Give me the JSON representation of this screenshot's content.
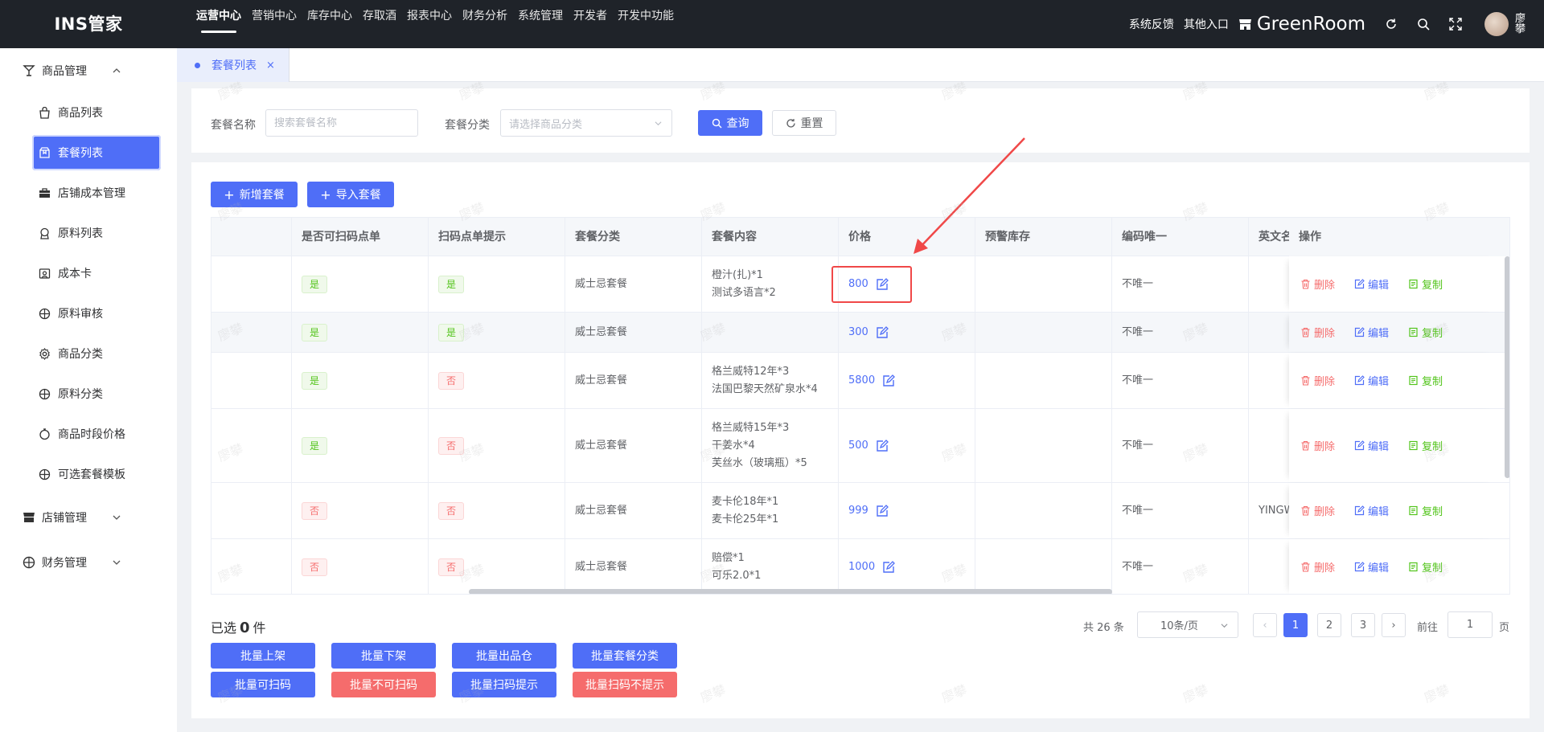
{
  "app": {
    "logo": "INS管家"
  },
  "topnav": [
    {
      "label": "运营中心",
      "active": true
    },
    {
      "label": "营销中心"
    },
    {
      "label": "库存中心"
    },
    {
      "label": "存取酒"
    },
    {
      "label": "报表中心"
    },
    {
      "label": "财务分析"
    },
    {
      "label": "系统管理"
    },
    {
      "label": "开发者"
    },
    {
      "label": "开发中功能"
    }
  ],
  "topright": {
    "feedback": "系统反馈",
    "other_entry": "其他入口",
    "store_name": "GreenRoom",
    "username": "廖攀"
  },
  "sidebar": {
    "groups": [
      {
        "label": "商品管理",
        "icon": "wine-glass-icon",
        "expanded": true
      },
      {
        "label": "店铺管理",
        "icon": "store-icon",
        "expanded": false
      },
      {
        "label": "财务管理",
        "icon": "finance-icon",
        "expanded": false
      }
    ],
    "items": [
      {
        "label": "商品列表",
        "icon": "bag-icon"
      },
      {
        "label": "套餐列表",
        "icon": "package-icon",
        "active": true
      },
      {
        "label": "店铺成本管理",
        "icon": "briefcase-icon"
      },
      {
        "label": "原料列表",
        "icon": "ingredient-icon"
      },
      {
        "label": "成本卡",
        "icon": "card-icon"
      },
      {
        "label": "原料审核",
        "icon": "audit-icon"
      },
      {
        "label": "商品分类",
        "icon": "category-gear-icon"
      },
      {
        "label": "原料分类",
        "icon": "ingredient-category-icon"
      },
      {
        "label": "商品时段价格",
        "icon": "clock-icon"
      },
      {
        "label": "可选套餐模板",
        "icon": "template-icon"
      }
    ]
  },
  "tabs": [
    {
      "label": "套餐列表",
      "close": "×"
    }
  ],
  "filters": {
    "name_label": "套餐名称",
    "name_placeholder": "搜索套餐名称",
    "category_label": "套餐分类",
    "category_placeholder": "请选择商品分类",
    "search_label": "查询",
    "reset_label": "重置"
  },
  "actions": {
    "add_label": "新增套餐",
    "import_label": "导入套餐"
  },
  "table": {
    "columns": [
      "",
      "是否可扫码点单",
      "扫码点单提示",
      "套餐分类",
      "套餐内容",
      "价格",
      "预警库存",
      "编码唯一",
      "英文名称",
      "操作"
    ],
    "ops": {
      "delete": "删除",
      "edit": "编辑",
      "copy": "复制"
    },
    "rows": [
      {
        "scan": "是",
        "hint": "是",
        "category": "威士忌套餐",
        "content": [
          "橙汁(扎)*1",
          "测试多语言*2"
        ],
        "price": "800",
        "stock": "",
        "unique": "不唯一",
        "en": ""
      },
      {
        "scan": "是",
        "hint": "是",
        "category": "威士忌套餐",
        "content": [],
        "price": "300",
        "stock": "",
        "unique": "不唯一",
        "en": ""
      },
      {
        "scan": "是",
        "hint": "否",
        "category": "威士忌套餐",
        "content": [
          "格兰威特12年*3",
          "法国巴黎天然矿泉水*4"
        ],
        "price": "5800",
        "stock": "",
        "unique": "不唯一",
        "en": ""
      },
      {
        "scan": "是",
        "hint": "否",
        "category": "威士忌套餐",
        "content": [
          "格兰威特15年*3",
          "干姜水*4",
          "芙丝水（玻璃瓶）*5"
        ],
        "price": "500",
        "stock": "",
        "unique": "不唯一",
        "en": ""
      },
      {
        "scan": "否",
        "hint": "否",
        "category": "威士忌套餐",
        "content": [
          "麦卡伦18年*1",
          "麦卡伦25年*1"
        ],
        "price": "999",
        "stock": "",
        "unique": "不唯一",
        "en": "YINGW"
      },
      {
        "scan": "否",
        "hint": "否",
        "category": "威士忌套餐",
        "content": [
          "赔偿*1",
          "可乐2.0*1"
        ],
        "price": "1000",
        "stock": "",
        "unique": "不唯一",
        "en": ""
      }
    ]
  },
  "footer": {
    "selected_prefix": "已选",
    "selected_count": "0",
    "selected_suffix": "件",
    "batch_buttons": [
      {
        "label": "批量上架",
        "color": "#4f6ef7"
      },
      {
        "label": "批量下架",
        "color": "#4f6ef7"
      },
      {
        "label": "批量出品仓",
        "color": "#4f6ef7"
      },
      {
        "label": "批量套餐分类",
        "color": "#4f6ef7"
      },
      {
        "label": "批量可扫码",
        "color": "#4f6ef7"
      },
      {
        "label": "批量不可扫码",
        "color": "#f56c6c"
      },
      {
        "label": "批量扫码提示",
        "color": "#4f6ef7"
      },
      {
        "label": "批量扫码不提示",
        "color": "#f56c6c"
      }
    ]
  },
  "pagination": {
    "total": "共 26 条",
    "page_size": "10条/页",
    "prev": "‹",
    "next": "›",
    "pages": [
      "1",
      "2",
      "3"
    ],
    "current": "1",
    "goto_label": "前往",
    "goto_value": "1",
    "goto_suffix": "页"
  },
  "watermark": "廖攀"
}
